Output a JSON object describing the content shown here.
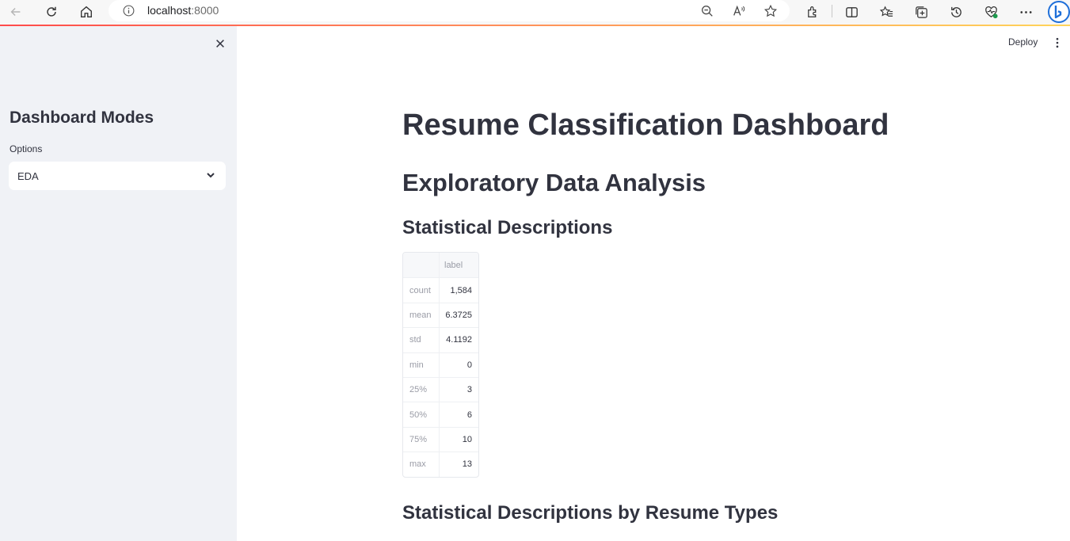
{
  "browser": {
    "url_host": "localhost",
    "url_port": ":8000",
    "icons": [
      "back-icon",
      "refresh-icon",
      "home-icon",
      "info-icon",
      "zoom-out-icon",
      "read-aloud-icon",
      "favorite-star-icon",
      "extensions-icon",
      "split-screen-icon",
      "favorites-icon",
      "collections-icon",
      "history-icon",
      "performance-icon",
      "more-icon",
      "bing-copilot-icon"
    ]
  },
  "sidebar": {
    "title": "Dashboard Modes",
    "select_label": "Options",
    "select_value": "EDA"
  },
  "header": {
    "deploy_label": "Deploy"
  },
  "main": {
    "title": "Resume Classification Dashboard",
    "section_title": "Exploratory Data Analysis",
    "subsection_1": "Statistical Descriptions",
    "subsection_2": "Statistical Descriptions by Resume Types",
    "table": {
      "column_header": "label",
      "rows": [
        {
          "index": "count",
          "value": "1,584"
        },
        {
          "index": "mean",
          "value": "6.3725"
        },
        {
          "index": "std",
          "value": "4.1192"
        },
        {
          "index": "min",
          "value": "0"
        },
        {
          "index": "25%",
          "value": "3"
        },
        {
          "index": "50%",
          "value": "6"
        },
        {
          "index": "75%",
          "value": "10"
        },
        {
          "index": "max",
          "value": "13"
        }
      ]
    }
  },
  "colors": {
    "accent": "#ff4b4b",
    "sidebar_bg": "#f0f2f6",
    "text": "#31333f"
  }
}
